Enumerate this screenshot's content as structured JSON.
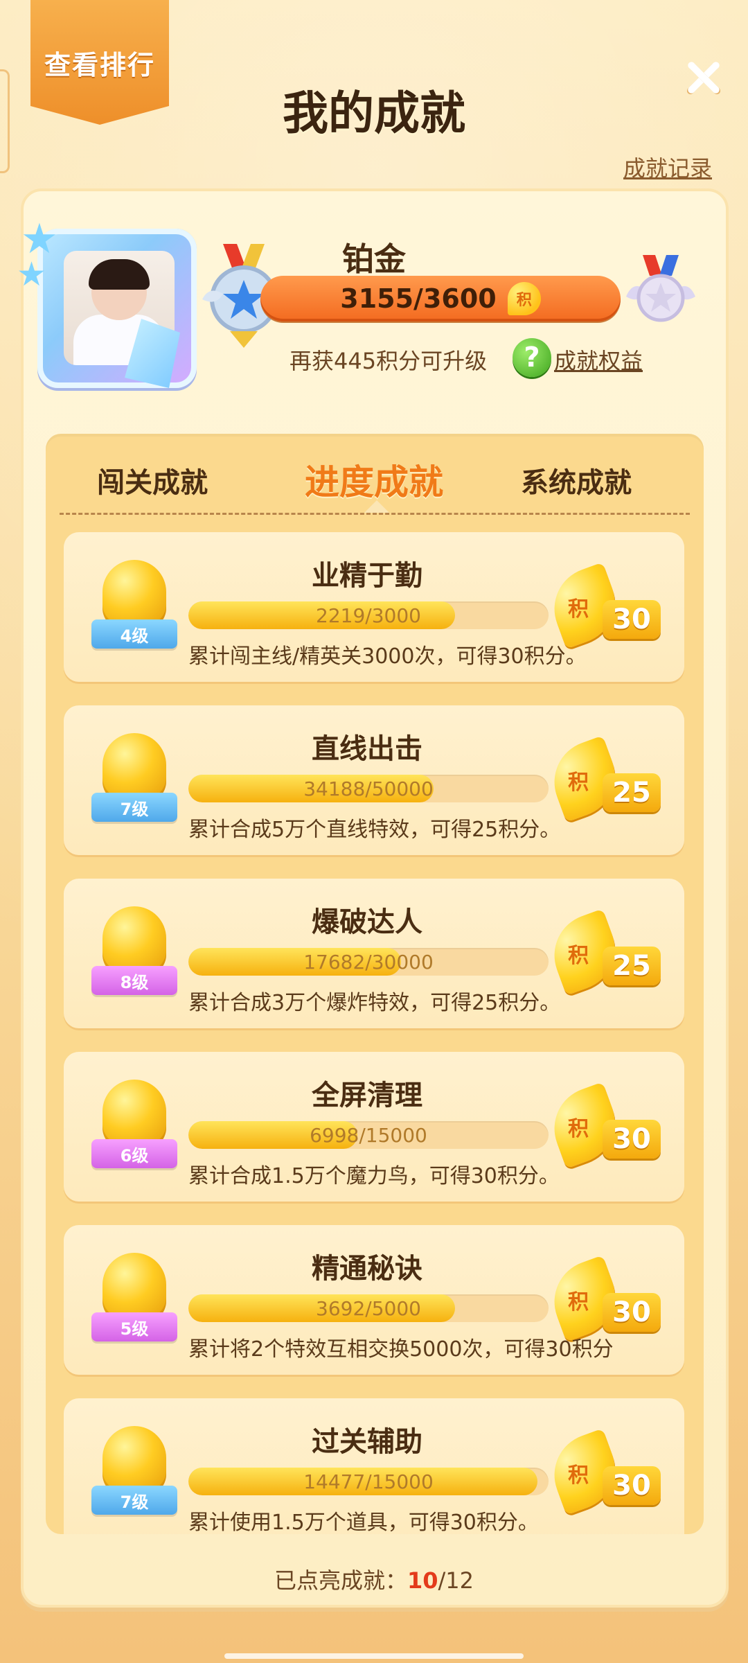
{
  "header": {
    "rank_button": "查看排行",
    "title": "我的成就",
    "record_link": "成就记录"
  },
  "profile": {
    "rank_name": "铂金",
    "score_text": "3155/3600",
    "score_current": 3155,
    "score_max": 3600,
    "ji_label": "积",
    "upgrade_text": "再获445积分可升级",
    "help_icon": "?",
    "benefit_link": "成就权益"
  },
  "tabs": [
    {
      "label": "闯关成就",
      "active": false
    },
    {
      "label": "进度成就",
      "active": true
    },
    {
      "label": "系统成就",
      "active": false
    }
  ],
  "achievements": [
    {
      "title": "业精于勤",
      "level": "4级",
      "level_color": "blue",
      "progress_text": "2219/3000",
      "progress": 0.74,
      "reward_label": "积",
      "reward": "30",
      "desc": "累计闯主线/精英关3000次，可得30积分。"
    },
    {
      "title": "直线出击",
      "level": "7级",
      "level_color": "blue",
      "progress_text": "34188/50000",
      "progress": 0.68,
      "reward_label": "积",
      "reward": "25",
      "desc": "累计合成5万个直线特效，可得25积分。"
    },
    {
      "title": "爆破达人",
      "level": "8级",
      "level_color": "pink",
      "progress_text": "17682/30000",
      "progress": 0.59,
      "reward_label": "积",
      "reward": "25",
      "desc": "累计合成3万个爆炸特效，可得25积分。"
    },
    {
      "title": "全屏清理",
      "level": "6级",
      "level_color": "pink",
      "progress_text": "6998/15000",
      "progress": 0.47,
      "reward_label": "积",
      "reward": "30",
      "desc": "累计合成1.5万个魔力鸟，可得30积分。"
    },
    {
      "title": "精通秘诀",
      "level": "5级",
      "level_color": "pink",
      "progress_text": "3692/5000",
      "progress": 0.74,
      "reward_label": "积",
      "reward": "30",
      "desc": "累计将2个特效互相交换5000次，可得30积分"
    },
    {
      "title": "过关辅助",
      "level": "7级",
      "level_color": "blue",
      "progress_text": "14477/15000",
      "progress": 0.97,
      "reward_label": "积",
      "reward": "30",
      "desc": "累计使用1.5万个道具，可得30积分。"
    }
  ],
  "footer": {
    "label": "已点亮成就：",
    "lit": "10",
    "total": "/12"
  },
  "colors": {
    "accent_orange": "#f07a18",
    "highlight_red": "#e33b1b",
    "level_blue": "#4fa8ea",
    "level_pink": "#d463e6"
  }
}
